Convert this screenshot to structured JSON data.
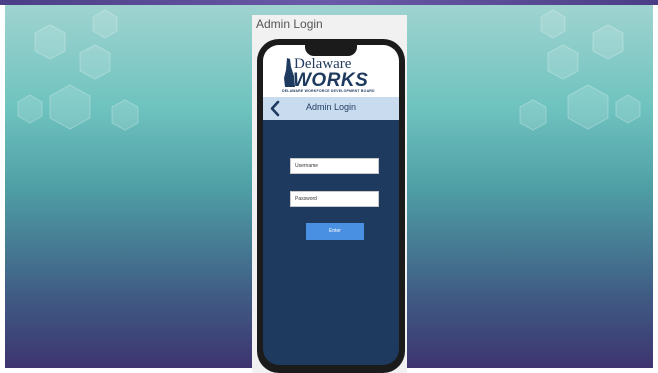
{
  "window": {
    "title": "Admin Login"
  },
  "logo": {
    "line1": "Delaware",
    "line2": "WORKS",
    "tagline": "DELAWARE WORKFORCE DEVELOPMENT BOARD"
  },
  "header": {
    "title": "Admin Login",
    "back_icon": "chevron-left-icon"
  },
  "form": {
    "username_placeholder": "Username",
    "password_placeholder": "Password",
    "enter_label": "Enter"
  },
  "colors": {
    "navy": "#1e3a5e",
    "header_bar": "#c9dcef",
    "button": "#4a90e2",
    "bg_teal": "#6fc3bf",
    "bg_purple": "#3e3470"
  }
}
